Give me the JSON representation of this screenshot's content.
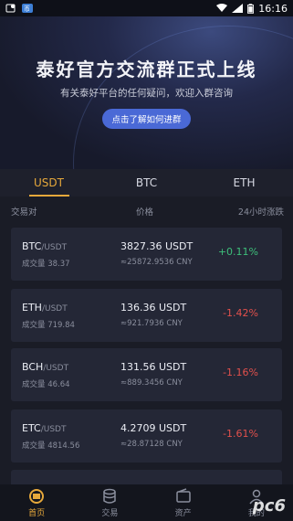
{
  "status": {
    "time": "16:16"
  },
  "banner": {
    "title": "泰好官方交流群正式上线",
    "subtitle": "有关泰好平台的任何疑问，欢迎入群咨询",
    "button": "点击了解如何进群"
  },
  "tabs": [
    {
      "label": "USDT",
      "active": true
    },
    {
      "label": "BTC",
      "active": false
    },
    {
      "label": "ETH",
      "active": false
    }
  ],
  "columns": {
    "pair": "交易对",
    "price": "价格",
    "change": "24小时涨跌"
  },
  "rows": [
    {
      "base": "BTC",
      "quote": "/USDT",
      "volume": "成交量 38.37",
      "price": "3827.36 USDT",
      "cny": "≈25872.9536 CNY",
      "change": "+0.11%"
    },
    {
      "base": "ETH",
      "quote": "/USDT",
      "volume": "成交量 719.84",
      "price": "136.36 USDT",
      "cny": "≈921.7936 CNY",
      "change": "-1.42%"
    },
    {
      "base": "BCH",
      "quote": "/USDT",
      "volume": "成交量 46.64",
      "price": "131.56 USDT",
      "cny": "≈889.3456 CNY",
      "change": "-1.16%"
    },
    {
      "base": "ETC",
      "quote": "/USDT",
      "volume": "成交量 4814.56",
      "price": "4.2709 USDT",
      "cny": "≈28.87128 CNY",
      "change": "-1.61%"
    }
  ],
  "bottom_nav": [
    {
      "label": "首页",
      "icon": "home-icon",
      "active": true
    },
    {
      "label": "交易",
      "icon": "coins-icon",
      "active": false
    },
    {
      "label": "资产",
      "icon": "wallet-icon",
      "active": false
    },
    {
      "label": "我的",
      "icon": "user-icon",
      "active": false
    }
  ],
  "watermark": "pc6",
  "colors": {
    "accent": "#e6a83b",
    "up": "#3dbf7a",
    "down": "#e2504c",
    "button": "#4a69d6"
  }
}
